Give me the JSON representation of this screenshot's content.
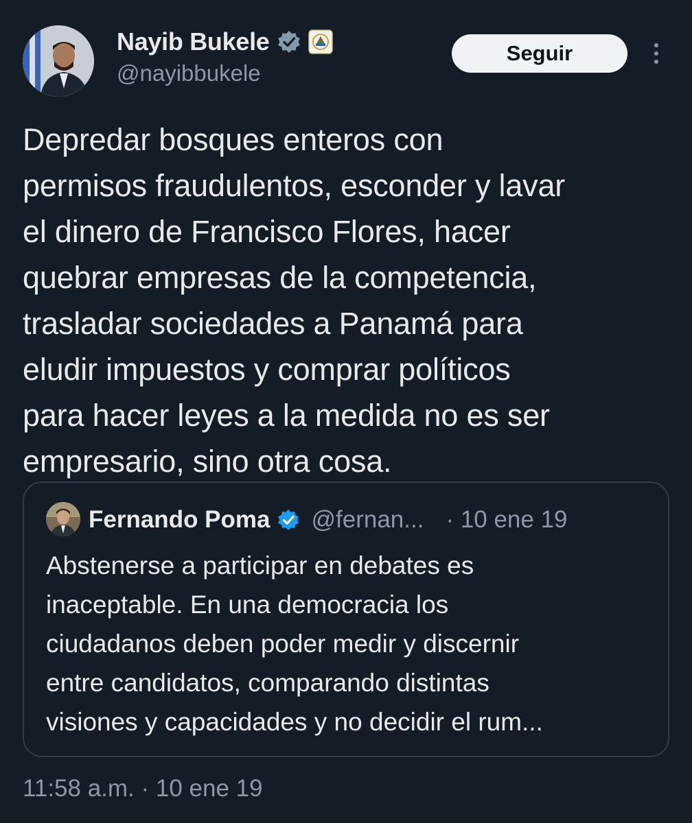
{
  "author": {
    "display_name": "Nayib Bukele",
    "handle": "@nayibbukele",
    "verified_icon": "verified-badge-icon",
    "affiliation_icon": "el-salvador-coat-of-arms-icon"
  },
  "follow_button": {
    "label": "Seguir"
  },
  "more_icon": "more-options-icon",
  "tweet": {
    "text": "Depredar bosques enteros con\npermisos fraudulentos, esconder y lavar\nel dinero de Francisco Flores, hacer\nquebrar empresas de la competencia,\ntrasladar sociedades a Panamá para\neludir impuestos y comprar políticos\npara hacer leyes a la medida no es ser\nempresario, sino otra cosa."
  },
  "quote": {
    "display_name": "Fernando Poma",
    "handle": "@fernan...",
    "date": "· 10 ene 19",
    "text": "Abstenerse a participar en debates es\ninaceptable.  En una democracia los\nciudadanos deben poder medir y discernir\nentre candidatos, comparando distintas\nvisiones y capacidades y no decidir el rum..."
  },
  "timestamp": "11:58 a.m. · 10 ene 19",
  "colors": {
    "background": "#141d26",
    "text": "#e7e9ea",
    "secondary_text": "#8b98a5",
    "verified_blue": "#1d9bf0",
    "verified_gray": "#829aab",
    "card_border": "#2f3b47"
  }
}
